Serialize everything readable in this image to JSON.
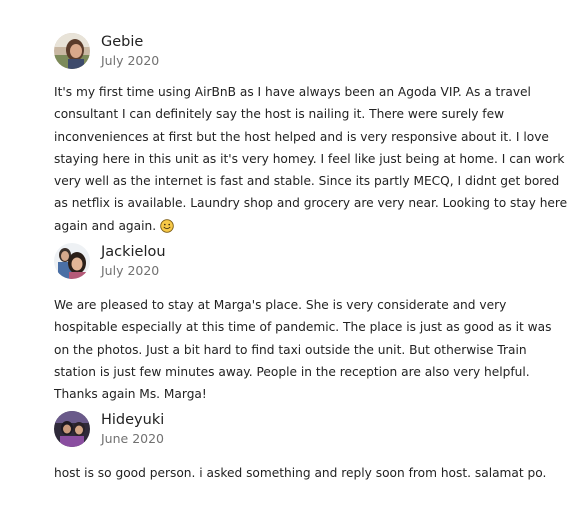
{
  "reviews": [
    {
      "name": "Gebie",
      "date": "July 2020",
      "avatar_icon": "user-photo-avatar",
      "text": "It's my first time using AirBnB as I have always been an Agoda VIP. As a travel consultant I can definitely say the host is nailing it. There were surely few inconveniences at first but the host helped and is very responsive about it. I love staying here in this unit as it's very homey. I feel like just being at home. I can work very well as the internet is fast and stable. Since its partly MECQ, I didnt get bored as netflix is available. Laundry shop and grocery are very near. Looking to stay here again and again.",
      "emoji_icon": "smiling-face-icon"
    },
    {
      "name": "Jackielou",
      "date": "July 2020",
      "avatar_icon": "user-photo-avatar",
      "text": "We are pleased to stay at Marga's place. She is very considerate and very hospitable especially at this time of pandemic. The place is just as good as it was on the photos. Just a bit hard to find taxi outside the unit. But otherwise Train station is just few minutes away. People in the reception are also very helpful. Thanks again Ms. Marga!"
    },
    {
      "name": "Hideyuki",
      "date": "June 2020",
      "avatar_icon": "user-photo-avatar",
      "text": "host is so good person. i asked something and reply soon from host. salamat po."
    }
  ]
}
